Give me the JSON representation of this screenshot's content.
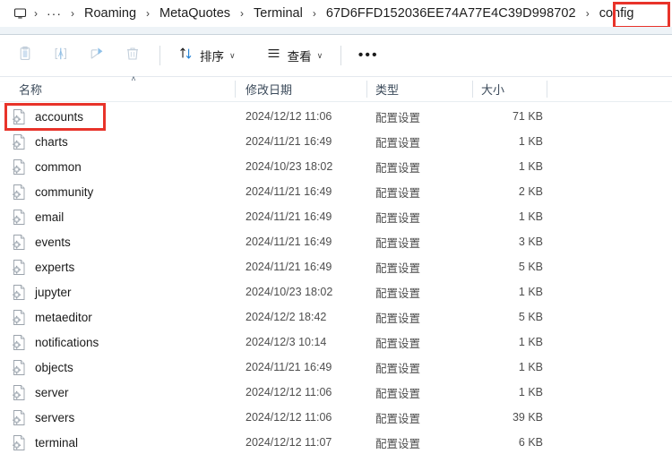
{
  "window": {
    "title": "config"
  },
  "breadcrumb": {
    "pc_icon": "monitor-icon",
    "ellipsis": "···",
    "separator": "›",
    "items": [
      {
        "label": "Roaming"
      },
      {
        "label": "MetaQuotes"
      },
      {
        "label": "Terminal"
      },
      {
        "label": "67D6FFD152036EE74A77E4C39D998702"
      },
      {
        "label": "config"
      }
    ],
    "highlight_color": "#e8332a",
    "highlighted_item": "config"
  },
  "toolbar": {
    "paste_label": "paste-icon",
    "rename_label": "rename-icon",
    "share_label": "share-icon",
    "delete_label": "delete-icon",
    "sort_label": "排序",
    "view_label": "查看",
    "more_label": "•••",
    "chevron": "∨"
  },
  "columns": {
    "name": "名称",
    "date_modified": "修改日期",
    "type": "类型",
    "size": "大小",
    "sort_indicator": "˄",
    "sorted_by": "名称",
    "sort_direction": "ascending"
  },
  "files": [
    {
      "name": "accounts",
      "date": "2024/12/12 11:06",
      "type": "配置设置",
      "size": "71 KB",
      "icon": "config-file-icon",
      "highlighted": true
    },
    {
      "name": "charts",
      "date": "2024/11/21 16:49",
      "type": "配置设置",
      "size": "1 KB",
      "icon": "config-file-icon",
      "highlighted": false
    },
    {
      "name": "common",
      "date": "2024/10/23 18:02",
      "type": "配置设置",
      "size": "1 KB",
      "icon": "config-file-icon",
      "highlighted": false
    },
    {
      "name": "community",
      "date": "2024/11/21 16:49",
      "type": "配置设置",
      "size": "2 KB",
      "icon": "config-file-icon",
      "highlighted": false
    },
    {
      "name": "email",
      "date": "2024/11/21 16:49",
      "type": "配置设置",
      "size": "1 KB",
      "icon": "config-file-icon",
      "highlighted": false
    },
    {
      "name": "events",
      "date": "2024/11/21 16:49",
      "type": "配置设置",
      "size": "3 KB",
      "icon": "config-file-icon",
      "highlighted": false
    },
    {
      "name": "experts",
      "date": "2024/11/21 16:49",
      "type": "配置设置",
      "size": "5 KB",
      "icon": "config-file-icon",
      "highlighted": false
    },
    {
      "name": "jupyter",
      "date": "2024/10/23 18:02",
      "type": "配置设置",
      "size": "1 KB",
      "icon": "config-file-icon",
      "highlighted": false
    },
    {
      "name": "metaeditor",
      "date": "2024/12/2 18:42",
      "type": "配置设置",
      "size": "5 KB",
      "icon": "config-file-icon",
      "highlighted": false
    },
    {
      "name": "notifications",
      "date": "2024/12/3 10:14",
      "type": "配置设置",
      "size": "1 KB",
      "icon": "config-file-icon",
      "highlighted": false
    },
    {
      "name": "objects",
      "date": "2024/11/21 16:49",
      "type": "配置设置",
      "size": "1 KB",
      "icon": "config-file-icon",
      "highlighted": false
    },
    {
      "name": "server",
      "date": "2024/12/12 11:06",
      "type": "配置设置",
      "size": "1 KB",
      "icon": "config-file-icon",
      "highlighted": false
    },
    {
      "name": "servers",
      "date": "2024/12/12 11:06",
      "type": "配置设置",
      "size": "39 KB",
      "icon": "config-file-icon",
      "highlighted": false
    },
    {
      "name": "terminal",
      "date": "2024/12/12 11:07",
      "type": "配置设置",
      "size": "6 KB",
      "icon": "config-file-icon",
      "highlighted": false
    }
  ]
}
